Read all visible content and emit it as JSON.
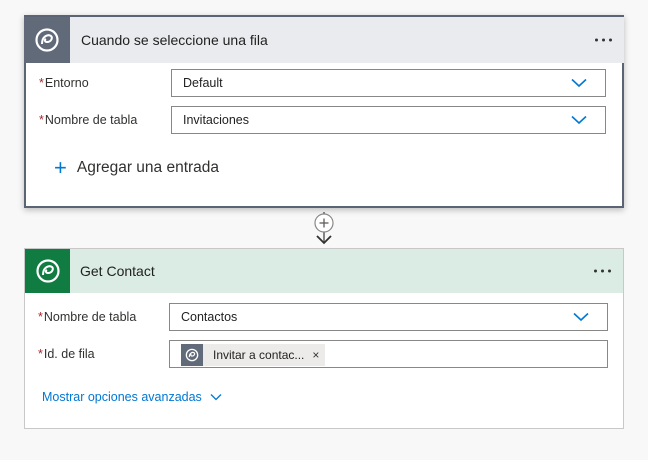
{
  "trigger": {
    "title": "Cuando se seleccione una fila",
    "fields": [
      {
        "required": "*",
        "label": "Entorno",
        "value": "Default"
      },
      {
        "required": "*",
        "label": "Nombre de tabla",
        "value": "Invitaciones"
      }
    ],
    "add_entry_label": "Agregar una entrada",
    "icon": "dataverse-icon"
  },
  "action": {
    "title": "Get Contact",
    "fields": [
      {
        "required": "*",
        "label": "Nombre de tabla",
        "value": "Contactos"
      },
      {
        "required": "*",
        "label": "Id. de fila",
        "token": "Invitar a contac...",
        "token_remove": "×"
      }
    ],
    "advanced_label": "Mostrar opciones avanzadas",
    "icon": "dataverse-icon"
  },
  "colors": {
    "accent": "#0078d4",
    "trigger_header_bg": "#e9ebee",
    "trigger_icon_bg": "#606a79",
    "action_header_bg": "#dbece4",
    "action_icon_bg": "#107c41",
    "required": "#a4262c"
  }
}
